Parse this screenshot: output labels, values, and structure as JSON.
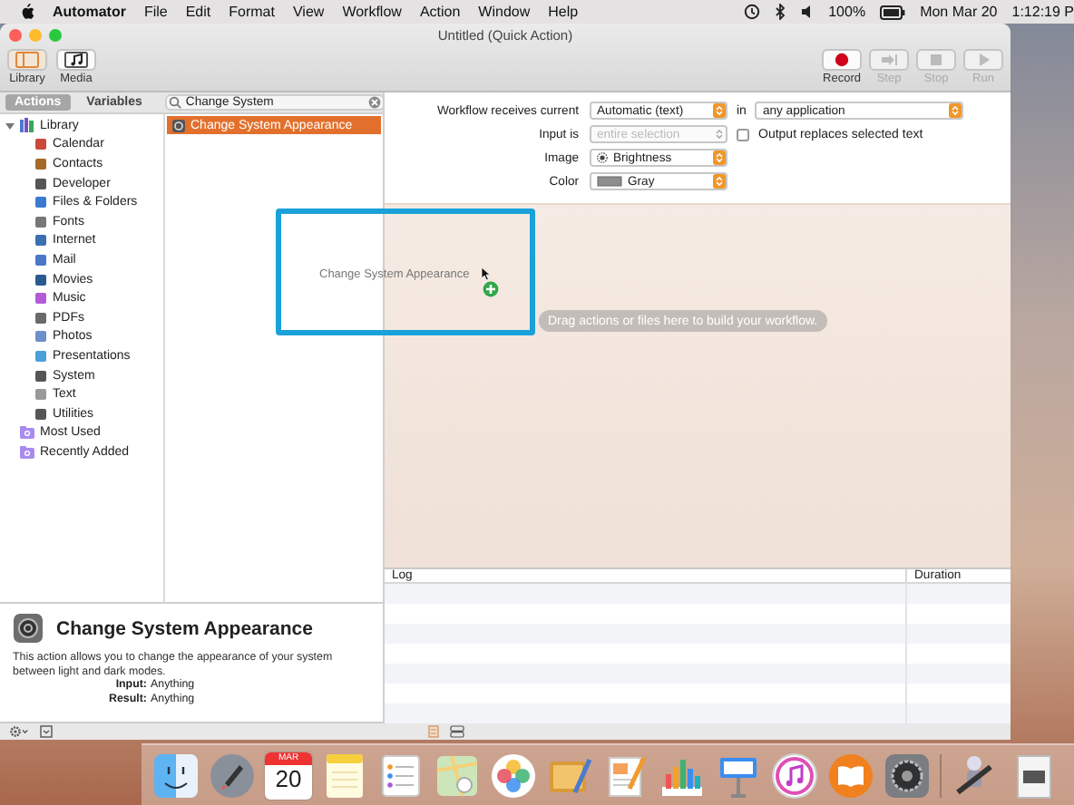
{
  "menu_bar": {
    "app": "Automator",
    "items": [
      "File",
      "Edit",
      "Format",
      "View",
      "Workflow",
      "Action",
      "Window",
      "Help"
    ],
    "battery": "100%",
    "date": "Mon Mar 20",
    "time": "1:12:19 P"
  },
  "window": {
    "title": "Untitled (Quick Action)",
    "toolbar_left": [
      {
        "label": "Library",
        "selected": true
      },
      {
        "label": "Media",
        "selected": false
      }
    ],
    "toolbar_right": [
      {
        "label": "Record",
        "kind": "record",
        "disabled": false
      },
      {
        "label": "Step",
        "kind": "step",
        "disabled": true
      },
      {
        "label": "Stop",
        "kind": "stop",
        "disabled": true
      },
      {
        "label": "Run",
        "kind": "run",
        "disabled": true
      }
    ]
  },
  "tabs": [
    {
      "label": "Actions",
      "selected": true
    },
    {
      "label": "Variables",
      "selected": false
    }
  ],
  "search": {
    "value": "Change System"
  },
  "library": {
    "label": "Library",
    "expanded": true,
    "children": [
      {
        "label": "Calendar"
      },
      {
        "label": "Contacts"
      },
      {
        "label": "Developer"
      },
      {
        "label": "Files & Folders"
      },
      {
        "label": "Fonts"
      },
      {
        "label": "Internet"
      },
      {
        "label": "Mail"
      },
      {
        "label": "Movies"
      },
      {
        "label": "Music"
      },
      {
        "label": "PDFs"
      },
      {
        "label": "Photos"
      },
      {
        "label": "Presentations"
      },
      {
        "label": "System"
      },
      {
        "label": "Text"
      },
      {
        "label": "Utilities"
      }
    ]
  },
  "smart_groups": [
    {
      "label": "Most Used"
    },
    {
      "label": "Recently Added"
    }
  ],
  "actions": [
    {
      "label": "Change System Appearance",
      "selected": true
    }
  ],
  "settings": {
    "receives_label": "Workflow receives current",
    "receives_value": "Automatic (text)",
    "in_label": "in",
    "app_value": "any application",
    "input_label": "Input is",
    "input_value": "entire selection",
    "input_disabled": true,
    "output_label": "Output replaces selected text",
    "output_checked": false,
    "image_label": "Image",
    "image_value": "Brightness",
    "color_label": "Color",
    "color_value": "Gray"
  },
  "drag": {
    "label": "Change System Appearance",
    "hint": "Drag actions or files here to build your workflow."
  },
  "log": {
    "columns": [
      "Log",
      "Duration"
    ]
  },
  "description": {
    "title": "Change System Appearance",
    "text": "This action allows you to change the appearance of your system between light and dark modes.",
    "fields": [
      {
        "label": "Input:",
        "value": "Anything"
      },
      {
        "label": "Result:",
        "value": "Anything"
      }
    ]
  },
  "dock": {
    "calendar_month": "MAR",
    "calendar_day": "20"
  }
}
